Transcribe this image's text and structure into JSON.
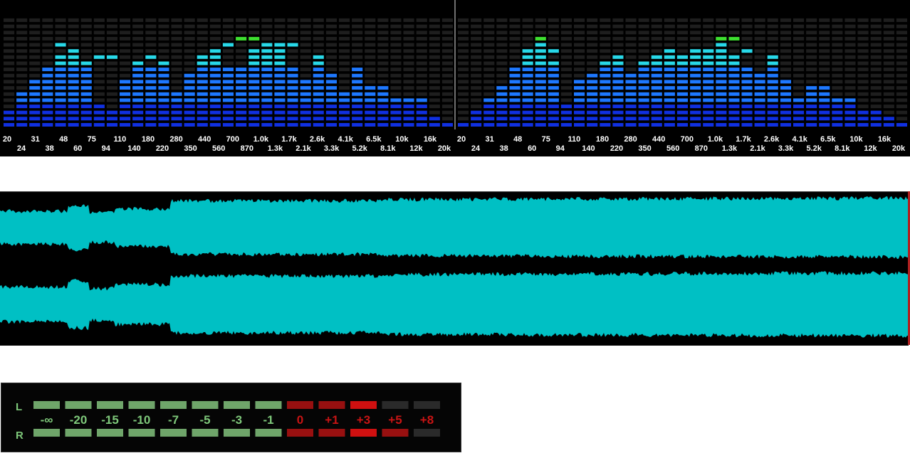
{
  "analyzer": {
    "channels": [
      {
        "name": "left",
        "levels": [
          3,
          6,
          8,
          10,
          12,
          13,
          11,
          4,
          3,
          8,
          11,
          10,
          11,
          6,
          9,
          12,
          13,
          10,
          10,
          13,
          14,
          14,
          10,
          8,
          12,
          9,
          6,
          10,
          7,
          7,
          5,
          5,
          5,
          2,
          1
        ]
      },
      {
        "name": "right",
        "levels": [
          1,
          3,
          5,
          7,
          10,
          13,
          15,
          11,
          4,
          8,
          9,
          10,
          12,
          9,
          11,
          12,
          13,
          12,
          13,
          13,
          15,
          12,
          10,
          9,
          12,
          8,
          5,
          7,
          7,
          5,
          5,
          3,
          3,
          2,
          1
        ]
      }
    ],
    "peaks": [
      [
        0,
        0,
        0,
        0,
        13,
        12,
        0,
        11,
        11,
        0,
        10,
        11,
        0,
        0,
        0,
        10,
        0,
        13,
        14,
        14,
        0,
        12,
        13,
        0,
        0,
        0,
        0,
        0,
        0,
        0,
        0,
        0,
        0,
        0,
        0
      ],
      [
        0,
        0,
        0,
        0,
        0,
        12,
        0,
        12,
        0,
        0,
        0,
        10,
        0,
        0,
        0,
        0,
        0,
        0,
        0,
        0,
        0,
        14,
        12,
        0,
        0,
        0,
        0,
        0,
        0,
        0,
        0,
        0,
        0,
        0,
        0
      ]
    ],
    "labels_top": [
      "20",
      "31",
      "48",
      "75",
      "110",
      "180",
      "280",
      "440",
      "700",
      "1.0k",
      "1.7k",
      "2.6k",
      "4.1k",
      "6.5k",
      "10k",
      "16k"
    ],
    "labels_bottom": [
      "24",
      "38",
      "60",
      "94",
      "140",
      "220",
      "350",
      "560",
      "870",
      "1.3k",
      "2.1k",
      "3.3k",
      "5.2k",
      "8.1k",
      "12k",
      "20k"
    ],
    "colors": {
      "blue": "#1030e0",
      "mid_blue": "#1e78ff",
      "cyan": "#28d8e8",
      "green": "#3ee030",
      "yellow": "#e8e010",
      "orange": "#ff8a10",
      "red": "#ff2810",
      "off": "#1e1e1e",
      "background": "#000000"
    }
  },
  "waveform": {
    "color": "#00c0c4",
    "cursor_color": "#b02020"
  },
  "vu_meter": {
    "channel_l": "L",
    "channel_r": "R",
    "ticks": [
      "-∞",
      "-20",
      "-15",
      "-10",
      "-7",
      "-5",
      "-3",
      "-1",
      "0",
      "+1",
      "+3",
      "+5",
      "+8"
    ],
    "l_segments_lit": 11,
    "r_segments_lit": 12,
    "colors": {
      "green": "#6fa56a",
      "red_lit": "#d01010",
      "red_dim": "#981010",
      "off": "#2a2a2a",
      "label_green": "#7ec87a",
      "label_red": "#c81414"
    }
  }
}
